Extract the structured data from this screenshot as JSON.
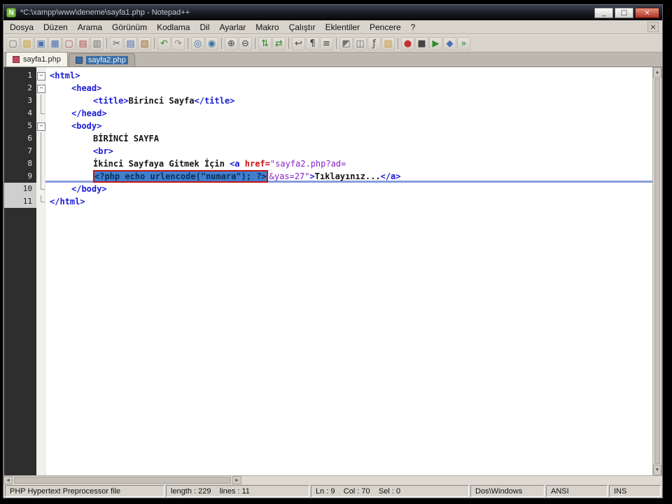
{
  "window": {
    "title": "*C:\\xampp\\www\\deneme\\sayfa1.php - Notepad++",
    "app_icon": "N",
    "controls": {
      "minimize": "_",
      "maximize": "□",
      "close": "×"
    }
  },
  "menu": {
    "items": [
      "Dosya",
      "Düzen",
      "Arama",
      "Görünüm",
      "Kodlama",
      "Dil",
      "Ayarlar",
      "Makro",
      "Çalıştır",
      "Eklentiler",
      "Pencere",
      "?"
    ],
    "close_glyph": "×"
  },
  "toolbar": {
    "icons": [
      {
        "name": "new-file-icon",
        "glyph": "▢",
        "color": "#6f6f6f"
      },
      {
        "name": "open-file-icon",
        "glyph": "▨",
        "color": "#c89a2e"
      },
      {
        "name": "save-icon",
        "glyph": "▣",
        "color": "#4a6fb5"
      },
      {
        "name": "save-all-icon",
        "glyph": "▦",
        "color": "#4a6fb5"
      },
      {
        "name": "close-file-icon",
        "glyph": "▢",
        "color": "#b05050"
      },
      {
        "name": "close-all-icon",
        "glyph": "▤",
        "color": "#b05050"
      },
      {
        "name": "print-icon",
        "glyph": "▥",
        "color": "#6f6f6f"
      },
      {
        "sep": true
      },
      {
        "name": "cut-icon",
        "glyph": "✂",
        "color": "#5a5a5a"
      },
      {
        "name": "copy-icon",
        "glyph": "▤",
        "color": "#4a6fb5"
      },
      {
        "name": "paste-icon",
        "glyph": "▧",
        "color": "#a06a2a"
      },
      {
        "sep": true
      },
      {
        "name": "undo-icon",
        "glyph": "↶",
        "color": "#2e8b2e"
      },
      {
        "name": "redo-icon",
        "glyph": "↷",
        "color": "#8a8a8a"
      },
      {
        "sep": true
      },
      {
        "name": "find-icon",
        "glyph": "◎",
        "color": "#3a6ea5"
      },
      {
        "name": "replace-icon",
        "glyph": "◉",
        "color": "#3a6ea5"
      },
      {
        "sep": true
      },
      {
        "name": "zoom-in-icon",
        "glyph": "⊕",
        "color": "#444444"
      },
      {
        "name": "zoom-out-icon",
        "glyph": "⊖",
        "color": "#444444"
      },
      {
        "sep": true
      },
      {
        "name": "sync-vertical-icon",
        "glyph": "⇅",
        "color": "#2e8b2e"
      },
      {
        "name": "sync-horizontal-icon",
        "glyph": "⇄",
        "color": "#2e8b2e"
      },
      {
        "sep": true
      },
      {
        "name": "word-wrap-icon",
        "glyph": "↩",
        "color": "#444444"
      },
      {
        "name": "show-all-characters-icon",
        "glyph": "¶",
        "color": "#444444"
      },
      {
        "name": "indent-guide-icon",
        "glyph": "≡",
        "color": "#444444"
      },
      {
        "sep": true
      },
      {
        "name": "user-defined-language-icon",
        "glyph": "◩",
        "color": "#6f6f6f"
      },
      {
        "name": "document-map-icon",
        "glyph": "◫",
        "color": "#6f6f6f"
      },
      {
        "name": "function-list-icon",
        "glyph": "ƒ",
        "color": "#444444"
      },
      {
        "name": "folder-as-workspace-icon",
        "glyph": "▨",
        "color": "#c89a2e"
      },
      {
        "sep": true
      },
      {
        "name": "record-macro-icon",
        "glyph": "●",
        "color": "#c23030"
      },
      {
        "name": "stop-macro-icon",
        "glyph": "■",
        "color": "#444444"
      },
      {
        "name": "play-macro-icon",
        "glyph": "▶",
        "color": "#2e8b2e"
      },
      {
        "name": "save-macro-icon",
        "glyph": "◆",
        "color": "#4a6fb5"
      },
      {
        "name": "run-macro-multiple-icon",
        "glyph": "»",
        "color": "#2e8b2e"
      }
    ]
  },
  "tabs": [
    {
      "label": "sayfa1.php",
      "state": "active",
      "icon_color": "#c2485e"
    },
    {
      "label": "sayfa2.php",
      "state": "inactive",
      "icon_color": "#3a6ea5"
    }
  ],
  "editor": {
    "lines": [
      {
        "n": "1",
        "indent": 0,
        "fold": "box",
        "tokens": [
          {
            "t": "<html>",
            "c": "tag"
          }
        ]
      },
      {
        "n": "2",
        "indent": 1,
        "fold": "box",
        "tokens": [
          {
            "t": "<head>",
            "c": "tag"
          }
        ]
      },
      {
        "n": "3",
        "indent": 2,
        "fold": "line",
        "tokens": [
          {
            "t": "<title>",
            "c": "tag"
          },
          {
            "t": "Birinci Sayfa",
            "c": "txt"
          },
          {
            "t": "</title>",
            "c": "tag"
          }
        ]
      },
      {
        "n": "4",
        "indent": 1,
        "fold": "end",
        "tokens": [
          {
            "t": "</head>",
            "c": "tag"
          }
        ]
      },
      {
        "n": "5",
        "indent": 1,
        "fold": "box",
        "tokens": [
          {
            "t": "<body>",
            "c": "tag"
          }
        ]
      },
      {
        "n": "6",
        "indent": 2,
        "fold": "line",
        "tokens": [
          {
            "t": "BİRİNCİ SAYFA",
            "c": "txt"
          }
        ]
      },
      {
        "n": "7",
        "indent": 2,
        "fold": "line",
        "tokens": [
          {
            "t": "<br>",
            "c": "tag"
          }
        ]
      },
      {
        "n": "8",
        "indent": 2,
        "fold": "line",
        "tokens": [
          {
            "t": "İkinci Sayfaya Gitmek İçin ",
            "c": "txt"
          },
          {
            "t": "<a",
            "c": "tag"
          },
          {
            "t": " href=",
            "c": "attr"
          },
          {
            "t": "\"sayfa2.php?ad=",
            "c": "val"
          }
        ]
      },
      {
        "n": "9",
        "indent": 2,
        "fold": "line",
        "cur": true,
        "tokens": [
          {
            "t": "<?php echo urlencode(\"numara\"); ?>",
            "c": "sel",
            "box": true
          },
          {
            "t": "&yas=27\"",
            "c": "val"
          },
          {
            "t": ">",
            "c": "tag"
          },
          {
            "t": "Tıklayınız...",
            "c": "txt"
          },
          {
            "t": "</a>",
            "c": "tag"
          }
        ]
      },
      {
        "n": "10",
        "indent": 1,
        "fold": "end",
        "hl": true,
        "tokens": [
          {
            "t": "</body>",
            "c": "tag"
          }
        ]
      },
      {
        "n": "11",
        "indent": 0,
        "fold": "end",
        "hl": true,
        "tokens": [
          {
            "t": "</html>",
            "c": "tag"
          }
        ]
      }
    ]
  },
  "scrollbars": {
    "up": "▲",
    "down": "▼",
    "left": "◄",
    "right": "►"
  },
  "statusbar": {
    "doctype": "PHP Hypertext Preprocessor file",
    "length_lines": "length : 229    lines : 11",
    "cursor": "Ln : 9    Col : 70    Sel : 0",
    "eol": "Dos\\Windows",
    "encoding": "ANSI",
    "mode": "INS"
  },
  "colors": {
    "selection": "#3f7fd0",
    "annotation_box": "#c41414",
    "tag": "#1a1ad8",
    "value": "#8520c8",
    "text": "#141414"
  }
}
